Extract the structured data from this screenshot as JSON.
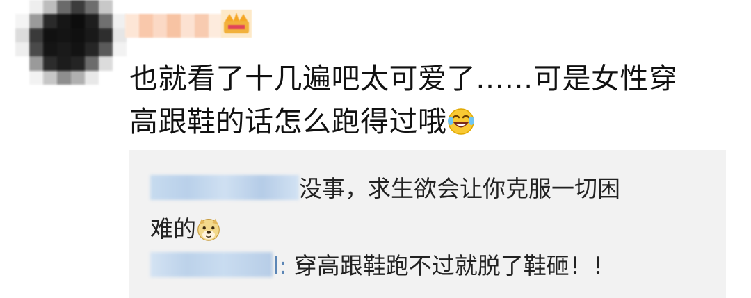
{
  "post": {
    "comment_text_line1": "也就看了十几遍吧太可爱了……可是女性穿",
    "comment_text_line2": "高跟鞋的话怎么跑得过哦",
    "comment_emoji": "laugh-cry-emoji",
    "avatar_icon": "pixelated-avatar",
    "badge_icon": "crown-icon"
  },
  "replies": [
    {
      "text_line1": "没事，求生欲会让你克服一切困",
      "text_line2": "难的",
      "emoji": "doge-emoji"
    },
    {
      "name_tail": "l:",
      "text": " 穿高跟鞋跑不过就脱了鞋砸！！"
    }
  ],
  "colors": {
    "text": "#111111",
    "reply_background": "#f2f2f2",
    "username_link": "#5b86b6"
  }
}
